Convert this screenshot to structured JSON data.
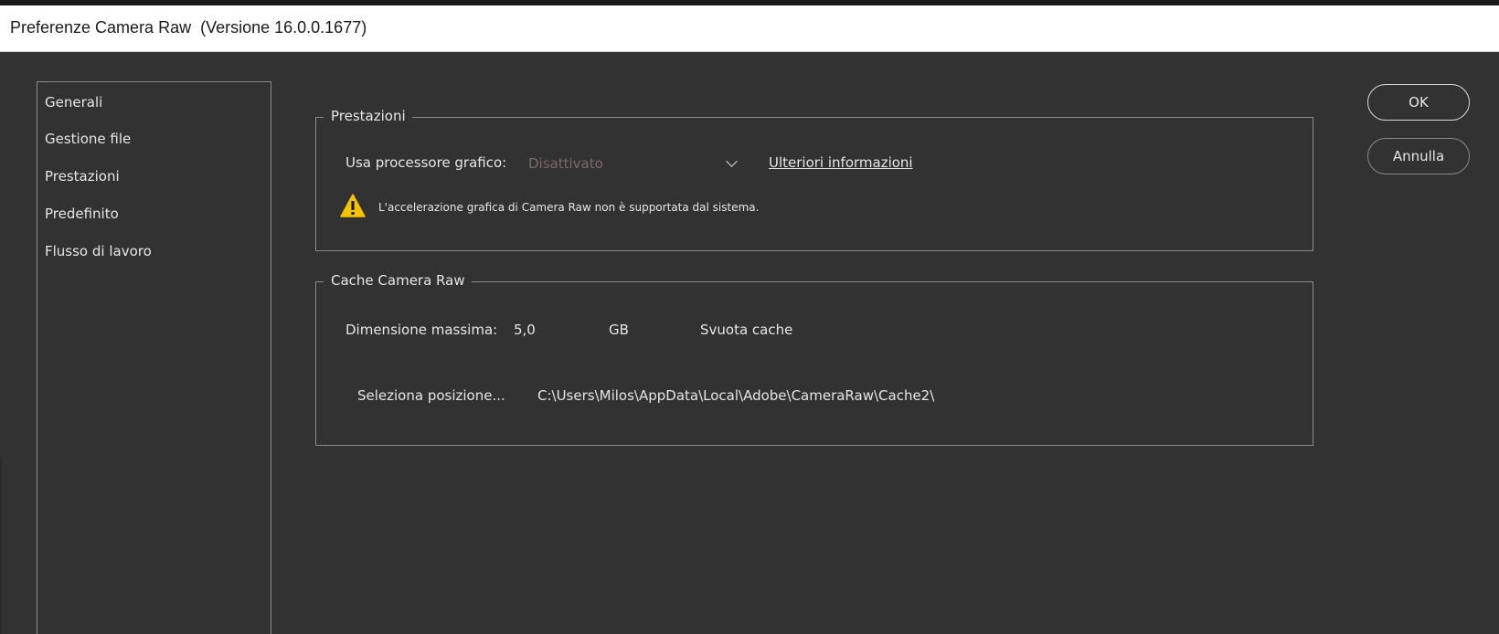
{
  "window": {
    "title": "Preferenze Camera Raw  (Versione 16.0.0.1677)"
  },
  "sidebar": {
    "items": [
      {
        "label": "Generali"
      },
      {
        "label": "Gestione file"
      },
      {
        "label": "Prestazioni"
      },
      {
        "label": "Predefinito"
      },
      {
        "label": "Flusso di lavoro"
      }
    ]
  },
  "performance": {
    "legend": "Prestazioni",
    "gpu_label": "Usa processore grafico:",
    "gpu_value": "Disattivato",
    "more_info_link": "Ulteriori informazioni",
    "warning_text": "L'accelerazione grafica di Camera Raw non è supportata dal sistema."
  },
  "cache": {
    "legend": "Cache Camera Raw",
    "max_size_label": "Dimensione massima:",
    "max_size_value": "5,0",
    "unit": "GB",
    "purge_button": "Svuota cache",
    "select_location_button": "Seleziona posizione...",
    "path": "C:\\Users\\Milos\\AppData\\Local\\Adobe\\CameraRaw\\Cache2\\"
  },
  "buttons": {
    "ok": "OK",
    "cancel": "Annulla"
  },
  "colors": {
    "background": "#323232",
    "border": "#8a8a8a",
    "text": "#e6e6e6",
    "disabled_text": "#7b6a6a",
    "warning": "#f5c400"
  },
  "icons": {
    "warning": "warning-triangle-icon",
    "dropdown": "chevron-down-icon"
  }
}
